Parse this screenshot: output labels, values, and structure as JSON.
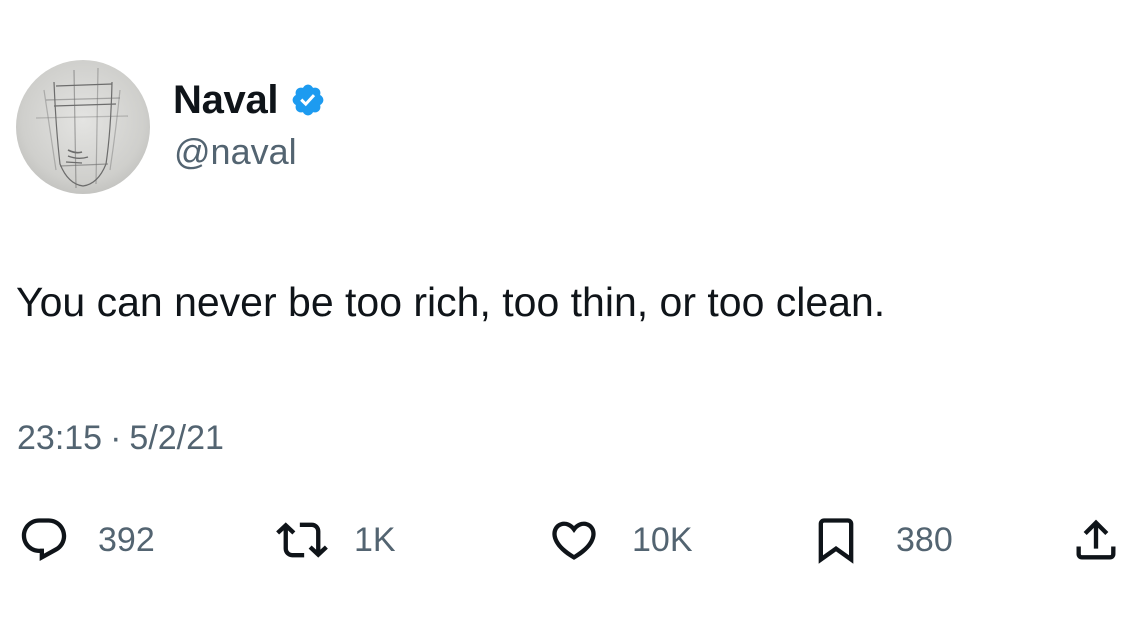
{
  "author": {
    "display_name": "Naval",
    "handle": "@naval",
    "verified": true,
    "avatar_icon": "sketched-face-avatar"
  },
  "tweet": {
    "text": "You can never be too rich, too thin, or too clean.",
    "time": "23:15",
    "separator": "·",
    "date": "5/2/21"
  },
  "actions": {
    "reply": {
      "icon": "reply-bubble-icon",
      "count": "392"
    },
    "retweet": {
      "icon": "retweet-arrows-icon",
      "count": "1K"
    },
    "like": {
      "icon": "heart-icon",
      "count": "10K"
    },
    "bookmark": {
      "icon": "bookmark-icon",
      "count": "380"
    },
    "share": {
      "icon": "share-upload-icon"
    }
  },
  "colors": {
    "text_primary": "#0f1419",
    "text_secondary": "#536471",
    "verified_blue": "#1d9bf0",
    "background": "#ffffff"
  }
}
